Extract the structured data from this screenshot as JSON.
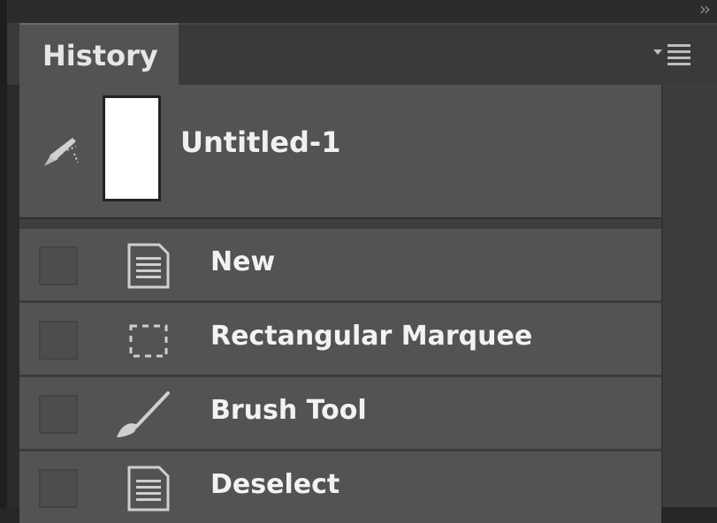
{
  "panel": {
    "tab_label": "History",
    "snapshot": {
      "label": "Untitled-1",
      "icon": "history-brush-icon"
    },
    "states": [
      {
        "label": "New",
        "icon": "document-icon"
      },
      {
        "label": "Rectangular Marquee",
        "icon": "marquee-icon"
      },
      {
        "label": "Brush Tool",
        "icon": "brush-icon"
      },
      {
        "label": "Deselect",
        "icon": "document-icon"
      }
    ]
  },
  "colors": {
    "panel_bg": "#535353",
    "text": "#f0f0f0"
  }
}
